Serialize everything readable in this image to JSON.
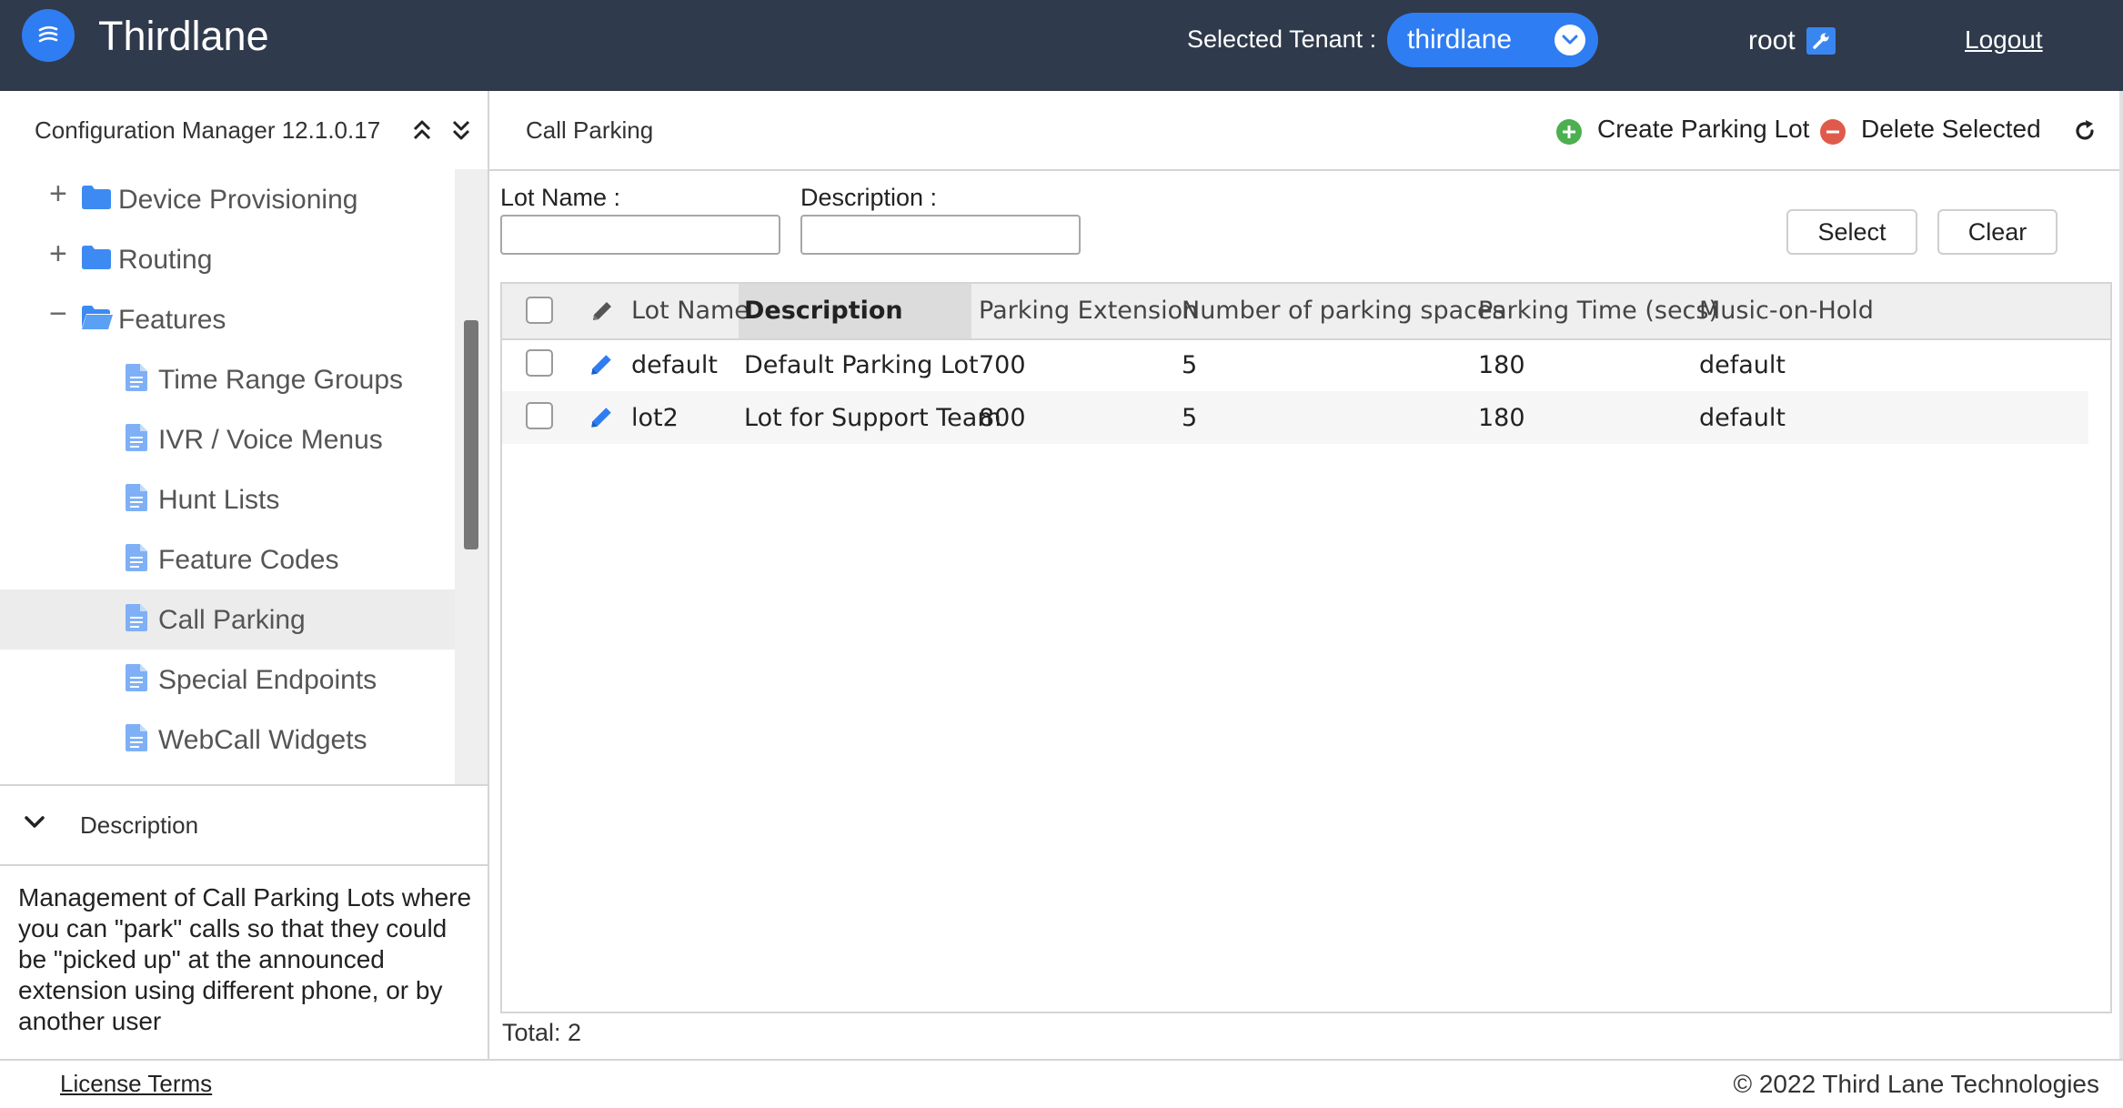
{
  "header": {
    "brand": "Thirdlane",
    "tenant_label": "Selected Tenant :",
    "tenant_value": "thirdlane",
    "user": "root",
    "logout": "Logout",
    "accent_color": "#2f7df2",
    "bg_color": "#2f3a4c"
  },
  "sidebar": {
    "title": "Configuration Manager 12.1.0.17",
    "items": [
      {
        "label": "Device Provisioning",
        "type": "folder",
        "toggle": "+"
      },
      {
        "label": "Routing",
        "type": "folder",
        "toggle": "+"
      },
      {
        "label": "Features",
        "type": "folder-open",
        "toggle": "−"
      },
      {
        "label": "Time Range Groups",
        "type": "file"
      },
      {
        "label": "IVR / Voice Menus",
        "type": "file"
      },
      {
        "label": "Hunt Lists",
        "type": "file"
      },
      {
        "label": "Feature Codes",
        "type": "file"
      },
      {
        "label": "Call Parking",
        "type": "file",
        "active": true
      },
      {
        "label": "Special Endpoints",
        "type": "file"
      },
      {
        "label": "WebCall Widgets",
        "type": "file"
      }
    ],
    "description_title": "Description",
    "description_text": "Management of Call Parking Lots where you can \"park\" calls so that they could be \"picked up\" at the announced extension using different phone, or by another user"
  },
  "main": {
    "title": "Call Parking",
    "create_label": "Create Parking Lot",
    "delete_label": "Delete Selected",
    "filters": {
      "lot_name_label": "Lot Name :",
      "lot_name_value": "",
      "description_label": "Description :",
      "description_value": "",
      "select_label": "Select",
      "clear_label": "Clear"
    },
    "table": {
      "columns": [
        "Lot Name",
        "Description",
        "Parking Extension",
        "Number of parking spaces",
        "Parking Time (secs)",
        "Music-on-Hold"
      ],
      "rows": [
        [
          "default",
          "Default Parking Lot",
          "700",
          "5",
          "180",
          "default"
        ],
        [
          "lot2",
          "Lot for Support Team",
          "800",
          "5",
          "180",
          "default"
        ]
      ],
      "total": "Total: 2"
    }
  },
  "footer": {
    "license": "License Terms",
    "copyright": "© 2022 Third Lane Technologies"
  }
}
